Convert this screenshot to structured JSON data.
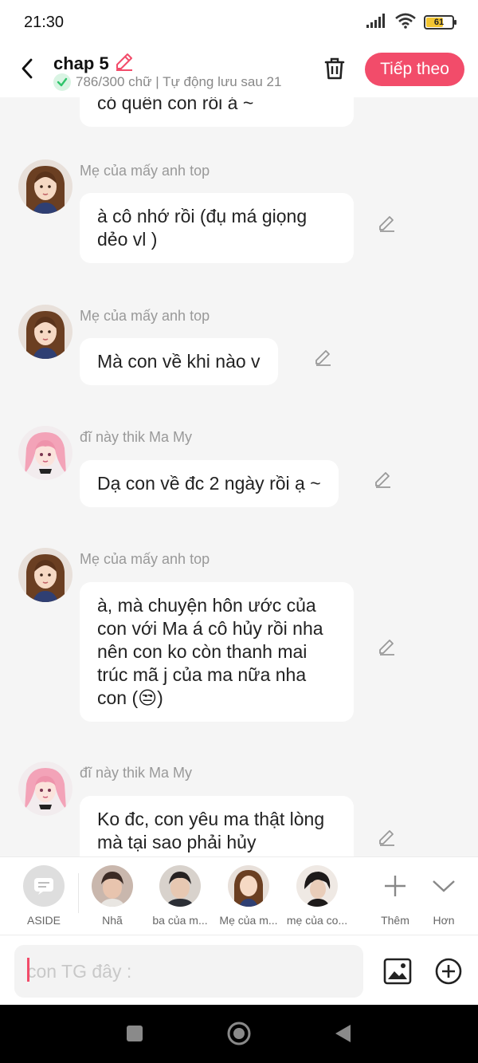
{
  "status": {
    "time": "21:30",
    "battery": "61",
    "battery_level": 0.61
  },
  "header": {
    "title": "chap 5",
    "subtitle": "786/300 chữ | Tự động lưu sau 21",
    "next_label": "Tiếp theo"
  },
  "messages": [
    {
      "name": "",
      "text": "có quên con rồi á ~"
    },
    {
      "name": "Mẹ của mấy anh top",
      "text": "à cô nhớ rồi (đụ má giọng dẻo vl )"
    },
    {
      "name": "Mẹ của mấy anh top",
      "text": "Mà con về khi nào v"
    },
    {
      "name": "đĩ này thik Ma My",
      "text": "Dạ con về đc 2 ngày rồi ạ ~"
    },
    {
      "name": "Mẹ của mấy anh top",
      "text": "à, mà chuyện hôn ước của con với Ma á cô hủy rồi nha nên con ko còn thanh mai trúc mã j của ma nữa nha con (😒)"
    },
    {
      "name": "đĩ này thik Ma My",
      "text": "Ko đc, con yêu ma thật lòng mà tại sao phải hủy"
    }
  ],
  "characters": [
    {
      "label": "ASIDE"
    },
    {
      "label": "Nhã"
    },
    {
      "label": "ba của m..."
    },
    {
      "label": "Mẹ của m..."
    },
    {
      "label": "mẹ của co..."
    }
  ],
  "actions": {
    "add_label": "Thêm",
    "more_label": "Hơn"
  },
  "input": {
    "placeholder": "con TG đây :"
  },
  "colors": {
    "accent": "#f24c6a",
    "success": "#2fc46b",
    "background": "#f5f5f5"
  }
}
